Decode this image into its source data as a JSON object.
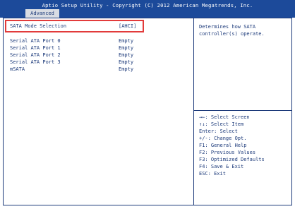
{
  "header": {
    "title": "Aptio Setup Utility - Copyright (C) 2012 American Megatrends, Inc.",
    "tab": "Advanced"
  },
  "main": {
    "selected_item": {
      "label": "SATA Mode Selection",
      "value": "[AHCI]"
    },
    "items": [
      {
        "label": "Serial ATA Port 0",
        "value": "Empty"
      },
      {
        "label": "Serial ATA Port 1",
        "value": "Empty"
      },
      {
        "label": "Serial ATA Port 2",
        "value": "Empty"
      },
      {
        "label": "Serial ATA Port 3",
        "value": "Empty"
      },
      {
        "label": "mSATA",
        "value": "Empty"
      }
    ]
  },
  "help": {
    "line1": "Determines how SATA",
    "line2": "controller(s) operate."
  },
  "keys": [
    "→←: Select Screen",
    "↑↓: Select Item",
    "Enter: Select",
    "+/-: Change Opt.",
    "F1: General Help",
    "F2: Previous Values",
    "F3: Optimized Defaults",
    "F4: Save & Exit",
    "ESC: Exit"
  ],
  "colors": {
    "header_bg": "#1c4a9a",
    "text": "#1c3a7a",
    "highlight_border": "#e23b3b"
  }
}
